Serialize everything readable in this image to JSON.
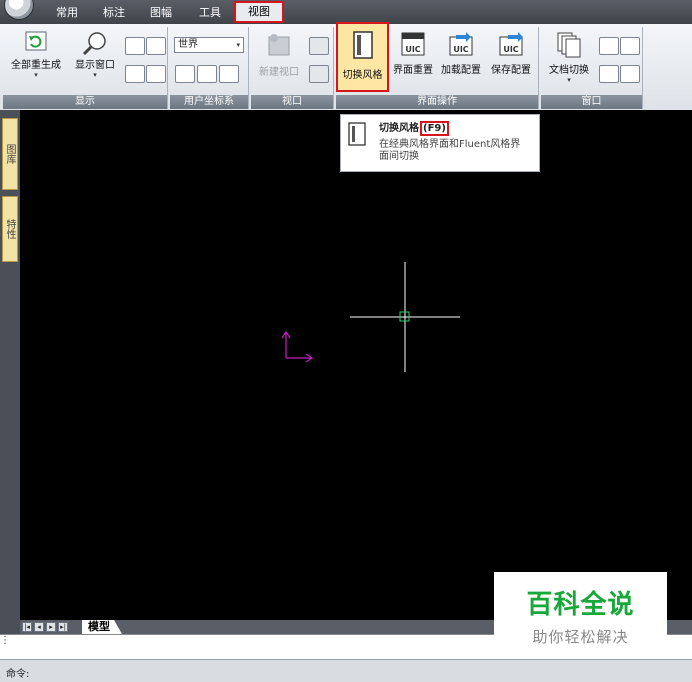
{
  "tabs": [
    "常用",
    "标注",
    "图幅",
    "工具",
    "视图"
  ],
  "active_tab": "视图",
  "ribbon": {
    "display": {
      "label": "显示",
      "regen_all": "全部重生成",
      "show_window": "显示窗口"
    },
    "ucs": {
      "label": "用户坐标系",
      "select_value": "世界"
    },
    "viewport": {
      "label": "视口",
      "new_viewport": "新建视口"
    },
    "ui_ops": {
      "label": "界面操作",
      "switch_style": "切换风格",
      "reset_ui": "界面重置",
      "load_config": "加载配置",
      "save_config": "保存配置"
    },
    "window": {
      "label": "窗口",
      "doc_switch": "文档切换"
    }
  },
  "tooltip": {
    "title": "切换风格",
    "shortcut": "(F9)",
    "desc_line1": "在经典风格界面和Fluent风格界",
    "desc_line2": "面间切换"
  },
  "left_dock": [
    "图库",
    "特性"
  ],
  "layout_tabs": [
    "模型"
  ],
  "command_prompt": "命令:",
  "watermark": {
    "title": "百科全说",
    "subtitle": "助你轻松解决"
  },
  "colors": {
    "highlight": "#d8141c",
    "ucs_icon": "#c020c0",
    "crosshair": "#ffffff",
    "pickbox": "#2ecc71",
    "watermark_green": "#18a83a"
  }
}
